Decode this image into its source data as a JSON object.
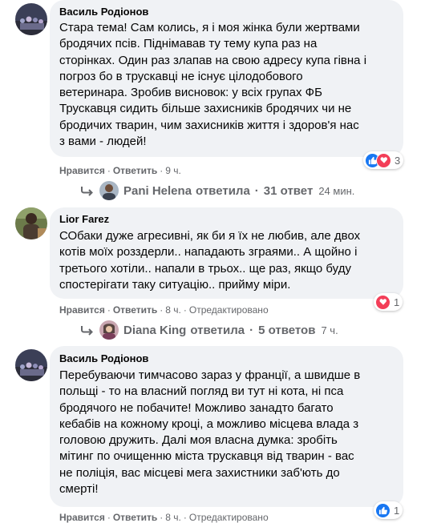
{
  "comments": [
    {
      "author": "Василь Родіонов",
      "text": "Стара тема! Сам колись, я і моя жінка були жертвами\nбродячих псів. Піднімавав ту тему купа раз на\nсторінках. Один раз злапав на свою адресу купа гівна і\nпогроз бо в трускавці не існує цілодобового\nветеринара. Зробив висновок: у всіх групах ФБ\nТрускавця сидить більше захисників бродячих чи не\nбродичих тварин, чим захисників життя і здоров'я нас\nз вами - людей!",
      "like": "Нравится",
      "reply": "Ответить",
      "time": "9 ч.",
      "reactions_count": "3",
      "replies": {
        "name": "Pani Helena",
        "label": "ответила",
        "count": "31 ответ",
        "time": "24 мин."
      }
    },
    {
      "author": "Lior Farez",
      "text": "СОбаки дуже агресивні, як би я їх не любив, але двох\nкотів моїх розздерли.. нападають зграями.. А щойно і\nтретього хотіли.. напали в трьох.. ще раз, якщо буду\nспостерігати таку ситуацію.. прийму міри.",
      "like": "Нравится",
      "reply": "Ответить",
      "time": "8 ч.",
      "edited": "Отредактировано",
      "reactions_count": "1",
      "replies": {
        "name": "Diana King",
        "label": "ответила",
        "count": "5 ответов",
        "time": "7 ч."
      }
    },
    {
      "author": "Василь Родіонов",
      "text": "Перебуваючи тимчасово зараз у франції, а швидше в\nпольщі - то на власний погляд ви тут ні кота, ні пса\nбродячого не побачите! Можливо занадто багато\nкебабів на кожному кроці, а можливо місцева влада з\nголовою дружить. Далі моя власна думка: зробіть\nмітинг по очищенню міста трускавця від тварин - вас\nне поліція, вас місцеві мега захистники заб'ють до\nсмерті!",
      "like": "Нравится",
      "reply": "Ответить",
      "time": "8 ч.",
      "edited": "Отредактировано",
      "reactions_count": "1"
    }
  ],
  "icons": {
    "like": "like-icon",
    "love": "love-icon",
    "care": "care-icon",
    "reply_arrow": "reply-arrow-icon"
  },
  "colors": {
    "bubble": "#f0f2f5",
    "like_blue": "#1877f2",
    "love_red": "#f33e58",
    "care_yellow": "#f7b125",
    "meta_gray": "#65676b"
  }
}
